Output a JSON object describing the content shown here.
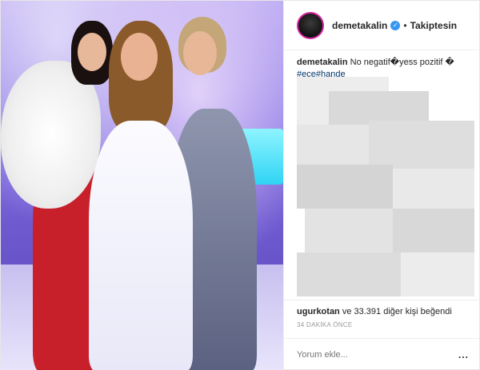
{
  "post": {
    "header": {
      "username": "demetakalin",
      "verified_icon": "verified-badge-icon",
      "separator": "•",
      "follow_status": "Takiptesin"
    },
    "caption": {
      "username": "demetakalin",
      "text": "No negatif�yess pozitif �",
      "tags": "#ece#hande"
    },
    "likes": {
      "user": "ugurkotan",
      "rest": " ve 33.391 diğer kişi beğendi"
    },
    "timestamp": "34 DAKİKA ÖNCE",
    "comment_box": {
      "placeholder": "Yorum ekle...",
      "more": "..."
    },
    "colors": {
      "verified": "#3897f0",
      "hashtag": "#003569",
      "muted": "#999999"
    }
  }
}
